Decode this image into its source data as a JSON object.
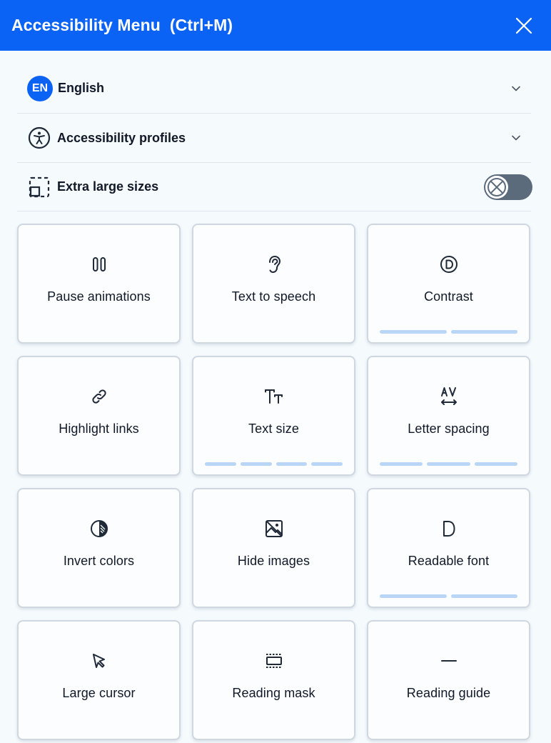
{
  "header": {
    "title": "Accessibility Menu  (Ctrl+M)",
    "background": "#0b63f6"
  },
  "language": {
    "badge": "EN",
    "label": "English"
  },
  "profiles": {
    "label": "Accessibility profiles"
  },
  "extra_large": {
    "label": "Extra large sizes",
    "enabled": false
  },
  "cards": {
    "pause": {
      "label": "Pause animations"
    },
    "tts": {
      "label": "Text to speech"
    },
    "contrast": {
      "label": "Contrast",
      "steps": 2
    },
    "highlight": {
      "label": "Highlight links"
    },
    "textsize": {
      "label": "Text size",
      "steps": 4
    },
    "letterspacing": {
      "label": "Letter spacing",
      "steps": 3
    },
    "invert": {
      "label": "Invert colors"
    },
    "hideimages": {
      "label": "Hide images"
    },
    "readablefont": {
      "label": "Readable font",
      "steps": 2
    },
    "cursor": {
      "label": "Large cursor"
    },
    "mask": {
      "label": "Reading mask"
    },
    "guide": {
      "label": "Reading guide"
    }
  },
  "colors": {
    "accent": "#0b63f6",
    "step_bar": "#b9d6f6",
    "toggle_off": "#5b6b7c"
  }
}
